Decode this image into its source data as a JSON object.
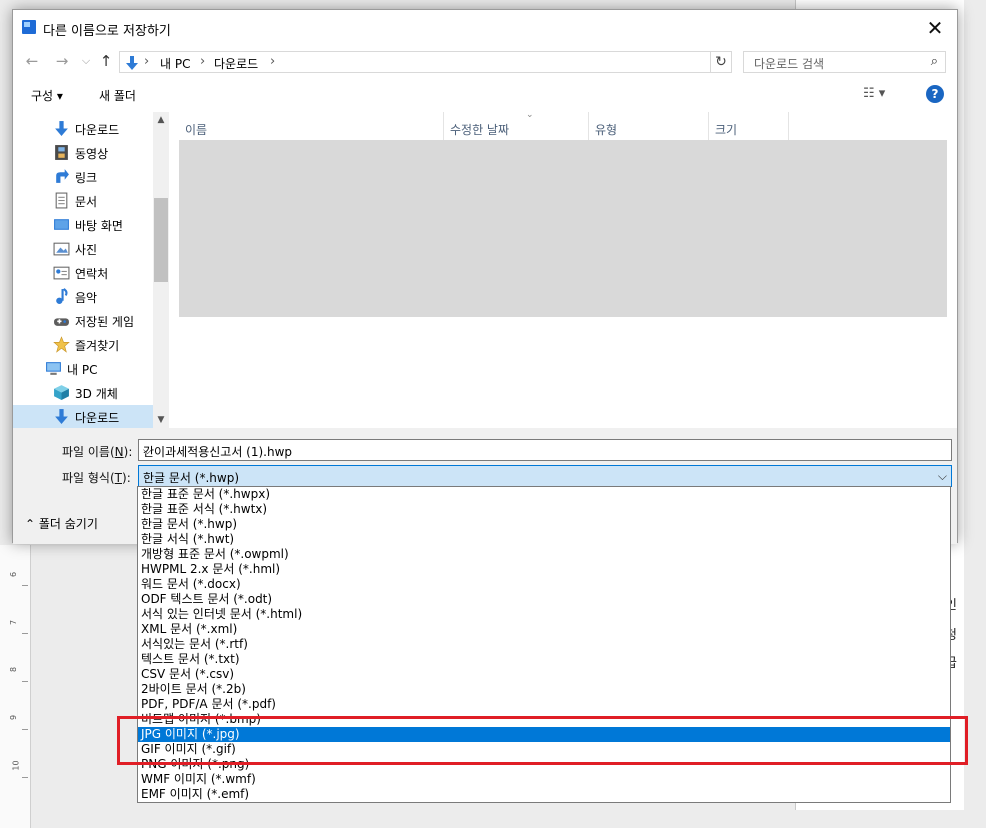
{
  "dialog": {
    "title": "다른 이름으로 저장하기",
    "close_glyph": "✕"
  },
  "nav": {
    "back": "←",
    "forward": "→",
    "recent": "⌵",
    "up": "↑",
    "breadcrumbs": [
      "내 PC",
      "다운로드"
    ],
    "sep": "›",
    "dropdown": "⌵",
    "refresh": "↻",
    "search_placeholder": "다운로드 검색",
    "search_icon": "⌕"
  },
  "toolbar": {
    "organize": "구성 ▾",
    "new_folder": "새 폴더",
    "view": "☷ ▾",
    "help": "?"
  },
  "sidebar": {
    "items": [
      {
        "label": "다운로드",
        "icon": "download-icon"
      },
      {
        "label": "동영상",
        "icon": "video-icon"
      },
      {
        "label": "링크",
        "icon": "link-icon"
      },
      {
        "label": "문서",
        "icon": "document-icon"
      },
      {
        "label": "바탕 화면",
        "icon": "desktop-icon"
      },
      {
        "label": "사진",
        "icon": "pictures-icon"
      },
      {
        "label": "연락처",
        "icon": "contacts-icon"
      },
      {
        "label": "음악",
        "icon": "music-icon"
      },
      {
        "label": "저장된 게임",
        "icon": "saved-games-icon"
      },
      {
        "label": "즐겨찾기",
        "icon": "favorites-icon"
      },
      {
        "label": "내 PC",
        "icon": "pc-icon"
      },
      {
        "label": "3D 개체",
        "icon": "3d-objects-icon"
      },
      {
        "label": "다운로드",
        "icon": "download-icon"
      }
    ],
    "scroll_up": "▲",
    "scroll_down": "▼"
  },
  "columns": [
    "이름",
    "수정한 날짜",
    "유형",
    "크기"
  ],
  "sort_arrow": "⌄",
  "bottom": {
    "filename_label": "파일 이름(",
    "filename_key": "N",
    "filename_suffix": "):",
    "filename_value": "간이과세적용신고서 (1).hwp",
    "filetype_label": "파일 형식(",
    "filetype_key": "T",
    "filetype_suffix": "):",
    "filetype_value": "한글 문서 (*.hwp)",
    "chevron": "⌵",
    "hide_folders": "⌃  폴더 숨기기"
  },
  "dropdown_options": [
    "한글 표준 문서 (*.hwpx)",
    "한글 표준 서식 (*.hwtx)",
    "한글 문서 (*.hwp)",
    "한글 서식 (*.hwt)",
    "개방형 표준 문서 (*.owpml)",
    "HWPML 2.x 문서 (*.hml)",
    "워드 문서 (*.docx)",
    "ODF 텍스트 문서 (*.odt)",
    "서식 있는 인터넷 문서 (*.html)",
    "XML 문서 (*.xml)",
    "서식있는 문서 (*.rtf)",
    "텍스트 문서 (*.txt)",
    "CSV 문서 (*.csv)",
    "2바이트 문서 (*.2b)",
    "PDF, PDF/A 문서 (*.pdf)",
    "비트맵 이미지 (*.bmp)",
    "JPG 이미지 (*.jpg)",
    "GIF 이미지 (*.gif)",
    "PNG 이미지 (*.png)",
    "WMF 이미지 (*.wmf)",
    "EMF 이미지 (*.emf)"
  ],
  "selected_option": "JPG 이미지 (*.jpg)",
  "highlight_color": "#e01e26",
  "accent_color": "#0078d7",
  "background": {
    "ruler_numbers": [
      "6",
      "7",
      "8",
      "9",
      "10"
    ],
    "fragments": [
      "인",
      "청",
      "급"
    ]
  }
}
